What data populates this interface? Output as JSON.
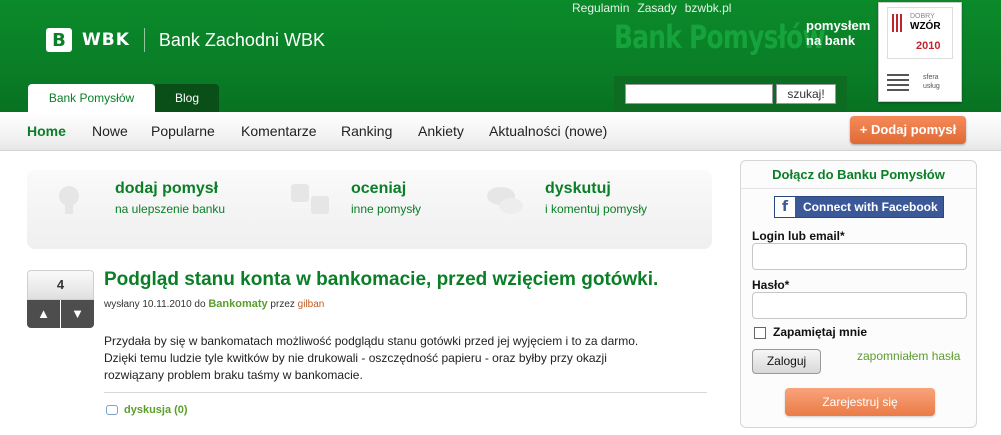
{
  "header": {
    "logo_mark": "B",
    "logo_word": "WBK",
    "bank_name": "Bank Zachodni WBK",
    "top_links": [
      "Regulamin",
      "Zasady",
      "bzwbk.pl"
    ],
    "brand_big": "Bank Pomysłów",
    "brand_small_1": "pomysłem",
    "brand_small_2": "na bank",
    "award": {
      "dobry": "DOBRY",
      "wzor": "WZÓR",
      "year": "2010",
      "sfera_1": "sfera",
      "sfera_2": "usług"
    },
    "search": {
      "value": "",
      "button": "szukaj!"
    },
    "tabs": [
      {
        "label": "Bank Pomysłów",
        "active": true
      },
      {
        "label": "Blog",
        "active": false
      }
    ]
  },
  "nav": {
    "items": [
      "Home",
      "Nowe",
      "Popularne",
      "Komentarze",
      "Ranking",
      "Ankiety",
      "Aktualności (nowe)"
    ],
    "add_button": "+ Dodaj pomysł"
  },
  "features": [
    {
      "title": "dodaj pomysł",
      "subtitle": "na ulepszenie banku",
      "icon": "lightbulb-icon"
    },
    {
      "title": "oceniaj",
      "subtitle": "inne pomysły",
      "icon": "vote-icon"
    },
    {
      "title": "dyskutuj",
      "subtitle": "i komentuj pomysły",
      "icon": "chat-icon"
    }
  ],
  "post": {
    "votes": "4",
    "title": "Podgląd stanu konta w bankomacie, przed wzięciem gotówki.",
    "meta_prefix": "wysłany 10.11.2010 do",
    "category": "Bankomaty",
    "meta_by": "przez",
    "author": "gilban",
    "body_lines": [
      "Przydała by się w bankomatach możliwość podglądu stanu gotówki przed jej wyjęciem i to za darmo.",
      "Dzięki temu ludzie tyle kwitków by nie drukowali - oszczędność papieru - oraz byłby przy okazji",
      "rozwiązany problem braku taśmy w bankomacie."
    ],
    "discussion": "dyskusja (0)"
  },
  "login": {
    "title": "Dołącz do Banku Pomysłów",
    "facebook_button": "Connect with Facebook",
    "email_label": "Login lub email*",
    "email_value": "",
    "password_label": "Hasło*",
    "password_value": "",
    "remember_label": "Zapamiętaj mnie",
    "login_button": "Zaloguj",
    "forgot_link": "zapomniałem hasła",
    "register_button": "Zarejestruj się"
  },
  "colors": {
    "green": "#0a7f27",
    "orange": "#e06a35",
    "facebook": "#3b5998"
  }
}
